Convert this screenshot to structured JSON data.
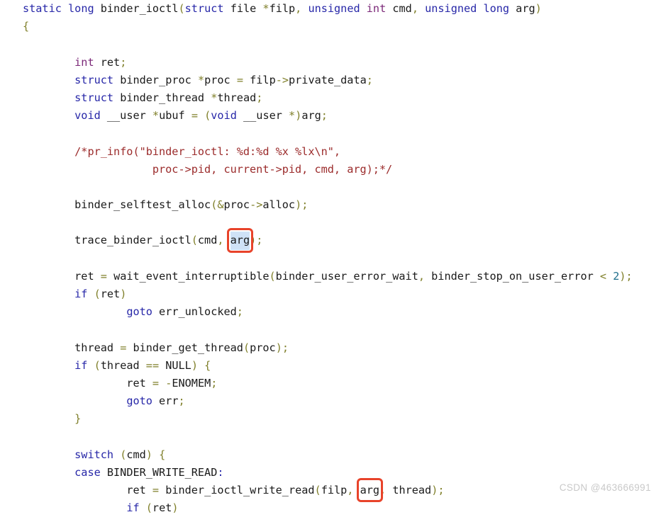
{
  "view": {
    "kind": "source-code-snippet",
    "language": "C",
    "background": "#ffffff",
    "function_name": "binder_ioctl"
  },
  "colors": {
    "keyword": "#2727a8",
    "builtin_type": "#7b2878",
    "identifier": "#1a1a1a",
    "operator": "#80802b",
    "number": "#1f6f8b",
    "comment": "#9b2b2b",
    "highlight_border": "#e8432a",
    "selection_background": "#cfe2f7",
    "watermark": "#c9c9c9"
  },
  "annotations": {
    "boxes": [
      {
        "id": "arg-box-1",
        "text": "arg",
        "line": 13,
        "selected": true
      },
      {
        "id": "arg-box-2",
        "text": "arg",
        "line": 31,
        "selected": false
      }
    ]
  },
  "watermark": {
    "text": "CSDN @463666991"
  },
  "code": {
    "lines": [
      {
        "n": 1,
        "indent": 0,
        "text": "static long binder_ioctl(struct file *filp, unsigned int cmd, unsigned long arg)"
      },
      {
        "n": 2,
        "indent": 0,
        "text": "{"
      },
      {
        "n": 3,
        "indent": 0,
        "text": ""
      },
      {
        "n": 4,
        "indent": 1,
        "text": "int ret;"
      },
      {
        "n": 5,
        "indent": 1,
        "text": "struct binder_proc *proc = filp->private_data;"
      },
      {
        "n": 6,
        "indent": 1,
        "text": "struct binder_thread *thread;"
      },
      {
        "n": 7,
        "indent": 1,
        "text": "void __user *ubuf = (void __user *)arg;"
      },
      {
        "n": 8,
        "indent": 0,
        "text": ""
      },
      {
        "n": 9,
        "indent": 1,
        "text": "/*pr_info(\"binder_ioctl: %d:%d %x %lx\\n\","
      },
      {
        "n": 10,
        "indent": 1,
        "text": "            proc->pid, current->pid, cmd, arg);*/"
      },
      {
        "n": 11,
        "indent": 0,
        "text": ""
      },
      {
        "n": 12,
        "indent": 1,
        "text": "binder_selftest_alloc(&proc->alloc);"
      },
      {
        "n": 13,
        "indent": 0,
        "text": ""
      },
      {
        "n": 14,
        "indent": 1,
        "text": "trace_binder_ioctl(cmd, arg);"
      },
      {
        "n": 15,
        "indent": 0,
        "text": ""
      },
      {
        "n": 16,
        "indent": 1,
        "text": "ret = wait_event_interruptible(binder_user_error_wait, binder_stop_on_user_error < 2);"
      },
      {
        "n": 17,
        "indent": 1,
        "text": "if (ret)"
      },
      {
        "n": 18,
        "indent": 2,
        "text": "goto err_unlocked;"
      },
      {
        "n": 19,
        "indent": 0,
        "text": ""
      },
      {
        "n": 20,
        "indent": 1,
        "text": "thread = binder_get_thread(proc);"
      },
      {
        "n": 21,
        "indent": 1,
        "text": "if (thread == NULL) {"
      },
      {
        "n": 22,
        "indent": 2,
        "text": "ret = -ENOMEM;"
      },
      {
        "n": 23,
        "indent": 2,
        "text": "goto err;"
      },
      {
        "n": 24,
        "indent": 1,
        "text": "}"
      },
      {
        "n": 25,
        "indent": 0,
        "text": ""
      },
      {
        "n": 26,
        "indent": 1,
        "text": "switch (cmd) {"
      },
      {
        "n": 27,
        "indent": 1,
        "text": "case BINDER_WRITE_READ:"
      },
      {
        "n": 28,
        "indent": 2,
        "text": "ret = binder_ioctl_write_read(filp, arg, thread);"
      },
      {
        "n": 29,
        "indent": 2,
        "text": "if (ret)"
      }
    ]
  }
}
